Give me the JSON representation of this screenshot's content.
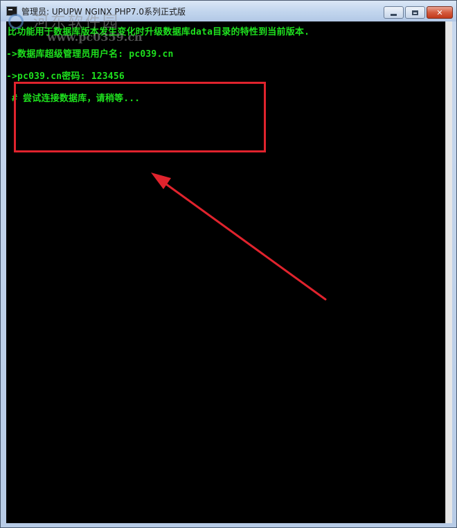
{
  "window": {
    "title": "管理员:  UPUPW NGINX PHP7.0系列正式版",
    "controls": {
      "minimize_icon": "minimize-icon",
      "maximize_icon": "maximize-icon",
      "close_icon": "close-icon"
    }
  },
  "console": {
    "lines": [
      "比功能用于数据库版本发生变化时升级数据库data目录的特性到当前版本.",
      "->数据库超级管理员用户名: pc039.cn",
      "->pc039.cn密码: 123456",
      "# 尝试连接数据库，请稍等..."
    ],
    "text_color": "#1ee11e",
    "background": "#000000"
  },
  "watermark": {
    "name": "河东软件园",
    "url": "www.pc0359.cn"
  },
  "annotation": {
    "color": "#e0232d"
  }
}
